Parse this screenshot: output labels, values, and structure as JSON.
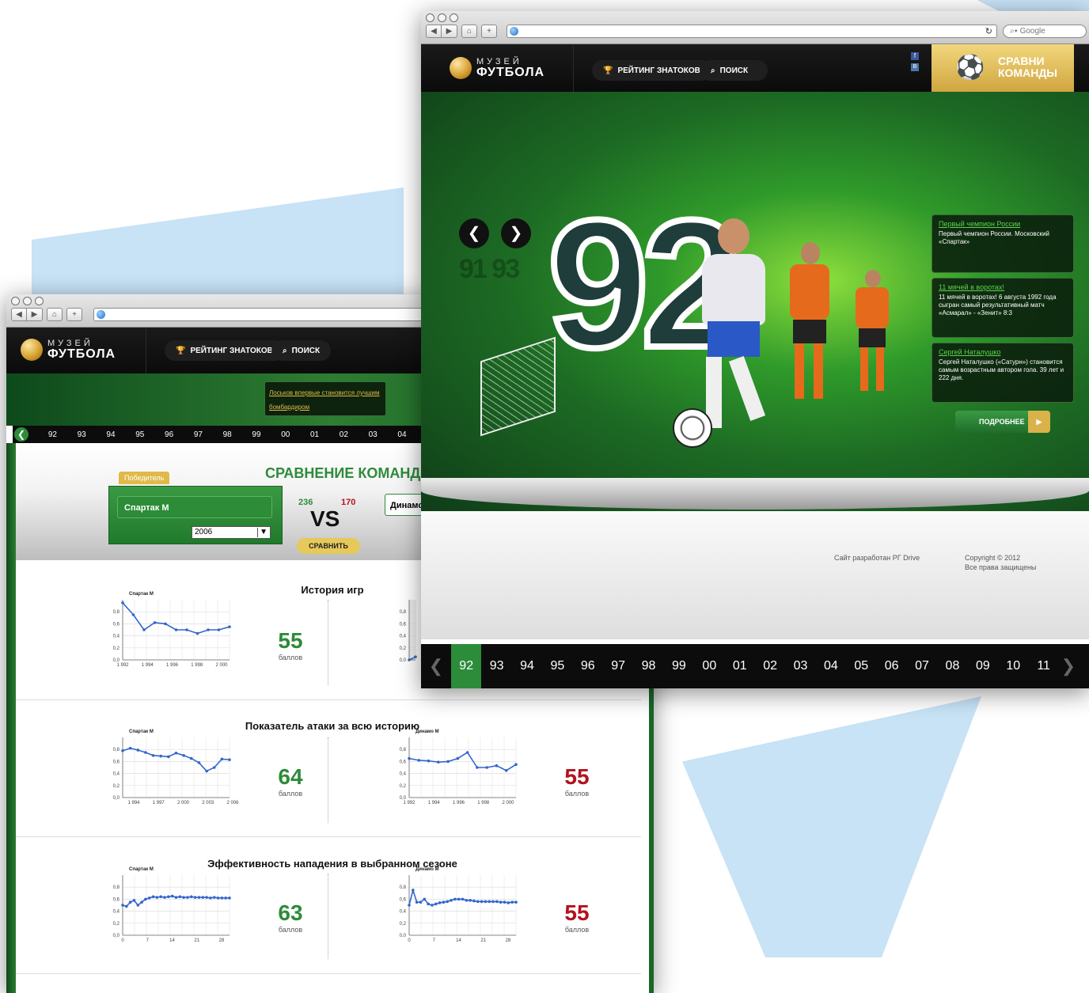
{
  "colors": {
    "accent_green": "#2e8b3a",
    "accent_red": "#b3121d",
    "background_shape": "#c8e2f6",
    "gold": "#d9b24a"
  },
  "browser": {
    "search_placeholder": "Google",
    "reload_icon": "reload-icon"
  },
  "site": {
    "logo_line1": "МУЗЕЙ",
    "logo_line2": "ФУТБОЛА",
    "nav_rating": "РЕЙТИНГ ЗНАТОКОВ",
    "nav_search": "ПОИСК",
    "compare_line1": "СРАВНИ",
    "compare_line2": "КОМАНДЫ",
    "social_fb": "f",
    "social_vk": "B"
  },
  "front": {
    "big_year": "92",
    "prev_year": "91",
    "next_year": "93",
    "news": [
      {
        "title": "Первый чемпион России",
        "text": "Первый чемпион России. Московский «Спартак»"
      },
      {
        "title": "11 мячей в воротах!",
        "text": "11 мячей в воротах! 6 августа 1992 года сыгран самый результативный матч «Асмарал» - «Зенит» 8:3"
      },
      {
        "title": "Сергей Наталушко",
        "text": "Сергей Наталушко («Сатурн») становится самым возрастным автором гола. 39 лет и 222 дня."
      }
    ],
    "more_button": "ПОДРОБНЕЕ",
    "footer_dev": "Сайт разработан РГ Drive",
    "footer_copy1": "Copyright © 2012",
    "footer_copy2": "Все права защищены",
    "years": [
      "92",
      "93",
      "94",
      "95",
      "96",
      "97",
      "98",
      "99",
      "00",
      "01",
      "02",
      "03",
      "04",
      "05",
      "06",
      "07",
      "08",
      "09",
      "10",
      "11"
    ],
    "active_year": "92"
  },
  "back": {
    "banner_news": "Лоськов впервые становится лучшим бомбардиром",
    "years": [
      "92",
      "93",
      "94",
      "95",
      "96",
      "97",
      "98",
      "99",
      "00",
      "01",
      "02",
      "03",
      "04"
    ],
    "compare_title": "СРАВНЕНИЕ КОМАНД",
    "winner_tab": "Победитель",
    "team1": "Спартак М",
    "team2": "Динамо",
    "season": "2006",
    "score1": "236",
    "score2": "170",
    "vs": "VS",
    "compare_button": "СРАВНИТЬ",
    "sections": [
      {
        "title": "История игр",
        "left_team": "Спартак М",
        "right_team": "Ди",
        "left_score": "55",
        "right_score": "",
        "unit": "баллов"
      },
      {
        "title": "Показатель атаки за всю историю",
        "left_team": "Спартак М",
        "right_team": "Динамо М",
        "left_score": "64",
        "right_score": "55",
        "unit": "баллов"
      },
      {
        "title": "Эффективность нападения в выбранном сезоне",
        "left_team": "Спартак М",
        "right_team": "Динамо М",
        "left_score": "63",
        "right_score": "55",
        "unit": "баллов"
      }
    ]
  },
  "chart_data": [
    {
      "type": "line",
      "title": "Спартак М",
      "x": [
        "1 992",
        "1 993",
        "1 994",
        "1 995",
        "1 996",
        "1 997",
        "1 998",
        "1 999",
        "2 000",
        "2 001",
        "2 002"
      ],
      "xticks": [
        "1 992",
        "1 994",
        "1 996",
        "1 998",
        "2 000"
      ],
      "values": [
        0.95,
        0.75,
        0.5,
        0.62,
        0.6,
        0.5,
        0.5,
        0.44,
        0.5,
        0.5,
        0.55
      ],
      "ylim": [
        0,
        1
      ],
      "yticks": [
        "0,0",
        "0,2",
        "0,4",
        "0,6",
        "0,8"
      ]
    },
    {
      "type": "line",
      "title": "",
      "x": [
        "1 992",
        "1 993"
      ],
      "values": [
        0.0,
        0.05
      ],
      "ylim": [
        0,
        1
      ],
      "yticks": [
        "0,0",
        "0,2",
        "0,4",
        "0,6",
        "0,8"
      ]
    },
    {
      "type": "line",
      "title": "Спартак М",
      "x": [
        "1 993",
        "1 994",
        "1 995",
        "1 996",
        "1 997",
        "1 998",
        "1 999",
        "2 000",
        "2 001",
        "2 002",
        "2 003",
        "2 004",
        "2 005",
        "2 006"
      ],
      "xticks": [
        "1 994",
        "1 997",
        "2 000",
        "2 003",
        "2 006"
      ],
      "values": [
        0.78,
        0.82,
        0.79,
        0.75,
        0.7,
        0.69,
        0.68,
        0.74,
        0.7,
        0.65,
        0.58,
        0.44,
        0.5,
        0.64,
        0.63
      ],
      "ylim": [
        0,
        1
      ],
      "yticks": [
        "0,0",
        "0,2",
        "0,4",
        "0,6",
        "0,8"
      ]
    },
    {
      "type": "line",
      "title": "Динамо М",
      "x": [
        "1 992",
        "1 993",
        "1 994",
        "1 995",
        "1 996",
        "1 997",
        "1 998",
        "1 999",
        "2 000",
        "2 001",
        "2 002",
        "2 003"
      ],
      "xticks": [
        "1 992",
        "1 994",
        "1 996",
        "1 998",
        "2 000"
      ],
      "values": [
        0.65,
        0.62,
        0.61,
        0.59,
        0.6,
        0.65,
        0.75,
        0.5,
        0.5,
        0.53,
        0.45,
        0.55
      ],
      "ylim": [
        0,
        1
      ],
      "yticks": [
        "0,0",
        "0,2",
        "0,4",
        "0,6",
        "0,8"
      ]
    },
    {
      "type": "line",
      "title": "Спартак М",
      "x": [
        0,
        1,
        2,
        3,
        4,
        5,
        6,
        7,
        8,
        9,
        10,
        11,
        12,
        13,
        14,
        15,
        16,
        17,
        18,
        19,
        20,
        21,
        22,
        23,
        24,
        25,
        26,
        27,
        28
      ],
      "xticks": [
        "0",
        "7",
        "14",
        "21",
        "28"
      ],
      "values": [
        0.5,
        0.48,
        0.55,
        0.58,
        0.5,
        0.55,
        0.6,
        0.62,
        0.64,
        0.63,
        0.64,
        0.63,
        0.64,
        0.65,
        0.63,
        0.64,
        0.63,
        0.63,
        0.64,
        0.63,
        0.63,
        0.63,
        0.63,
        0.62,
        0.63,
        0.62,
        0.62,
        0.62,
        0.62
      ],
      "ylim": [
        0,
        1
      ],
      "yticks": [
        "0,0",
        "0,2",
        "0,4",
        "0,6",
        "0,8"
      ]
    },
    {
      "type": "line",
      "title": "Динамо М",
      "x": [
        0,
        1,
        2,
        3,
        4,
        5,
        6,
        7,
        8,
        9,
        10,
        11,
        12,
        13,
        14,
        15,
        16,
        17,
        18,
        19,
        20,
        21,
        22,
        23,
        24,
        25,
        26,
        27,
        28
      ],
      "xticks": [
        "0",
        "7",
        "14",
        "21",
        "28"
      ],
      "values": [
        0.5,
        0.75,
        0.55,
        0.55,
        0.6,
        0.52,
        0.5,
        0.52,
        0.54,
        0.55,
        0.56,
        0.58,
        0.6,
        0.6,
        0.6,
        0.58,
        0.58,
        0.57,
        0.56,
        0.56,
        0.56,
        0.56,
        0.56,
        0.56,
        0.55,
        0.55,
        0.54,
        0.55,
        0.55
      ],
      "ylim": [
        0,
        1
      ],
      "yticks": [
        "0,0",
        "0,2",
        "0,4",
        "0,6",
        "0,8"
      ]
    }
  ]
}
